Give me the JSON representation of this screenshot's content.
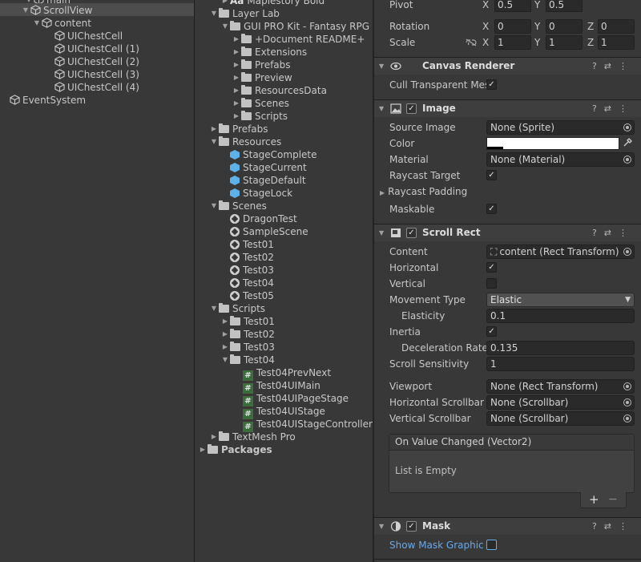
{
  "hierarchy": {
    "top_partial": "main",
    "items": [
      {
        "label": "ScrollView",
        "selected": true
      },
      {
        "label": "content"
      },
      {
        "label": "UIChestCell"
      },
      {
        "label": "UIChestCell (1)"
      },
      {
        "label": "UIChestCell (2)"
      },
      {
        "label": "UIChestCell (3)"
      },
      {
        "label": "UIChestCell (4)"
      },
      {
        "label": "EventSystem"
      }
    ]
  },
  "project": {
    "font_asset": "Maplestory Bold",
    "items": [
      "Layer Lab",
      "GUI PRO Kit - Fantasy RPG",
      "+Document README+",
      "Extensions",
      "Prefabs",
      "Preview",
      "ResourcesData",
      "Scenes",
      "Scripts",
      "Prefabs",
      "Resources",
      "StageComplete",
      "StageCurrent",
      "StageDefault",
      "StageLock",
      "Scenes",
      "DragonTest",
      "SampleScene",
      "Test01",
      "Test02",
      "Test03",
      "Test04",
      "Test05",
      "Scripts",
      "Test01",
      "Test02",
      "Test03",
      "Test04",
      "Test04PrevNext",
      "Test04UIMain",
      "Test04UIPageStage",
      "Test04UIStage",
      "Test04UIStageController",
      "TextMesh Pro",
      "Packages"
    ]
  },
  "inspector": {
    "pivot": {
      "label": "Pivot",
      "x": "0.5",
      "y": "0.5"
    },
    "rotation": {
      "label": "Rotation",
      "x": "0",
      "y": "0",
      "z": "0"
    },
    "scale": {
      "label": "Scale",
      "x": "1",
      "y": "1",
      "z": "1"
    },
    "axis": {
      "x": "X",
      "y": "Y",
      "z": "Z"
    },
    "canvas_renderer": {
      "title": "Canvas Renderer",
      "cull_label": "Cull Transparent Mes",
      "cull": true
    },
    "image": {
      "title": "Image",
      "source_image_label": "Source Image",
      "source_image": "None (Sprite)",
      "color_label": "Color",
      "material_label": "Material",
      "material": "None (Material)",
      "raycast_target_label": "Raycast Target",
      "raycast_padding_label": "Raycast Padding",
      "maskable_label": "Maskable"
    },
    "scroll_rect": {
      "title": "Scroll Rect",
      "content_label": "Content",
      "content": "content (Rect Transform)",
      "horizontal_label": "Horizontal",
      "vertical_label": "Vertical",
      "movement_type_label": "Movement Type",
      "movement_type": "Elastic",
      "elasticity_label": "Elasticity",
      "elasticity": "0.1",
      "inertia_label": "Inertia",
      "deceleration_label": "Deceleration Rate",
      "deceleration": "0.135",
      "sensitivity_label": "Scroll Sensitivity",
      "sensitivity": "1",
      "viewport_label": "Viewport",
      "viewport": "None (Rect Transform)",
      "hscroll_label": "Horizontal Scrollbar",
      "hscroll": "None (Scrollbar)",
      "vscroll_label": "Vertical Scrollbar",
      "vscroll": "None (Scrollbar)",
      "event_title": "On Value Changed (Vector2)",
      "event_empty": "List is Empty",
      "add": "+",
      "remove": "−"
    },
    "mask": {
      "title": "Mask",
      "show_graphic_label": "Show Mask Graphic"
    },
    "colors": {
      "accent_link": "#6aa8e8",
      "panel": "#383838",
      "field": "#2a2a2a"
    }
  }
}
